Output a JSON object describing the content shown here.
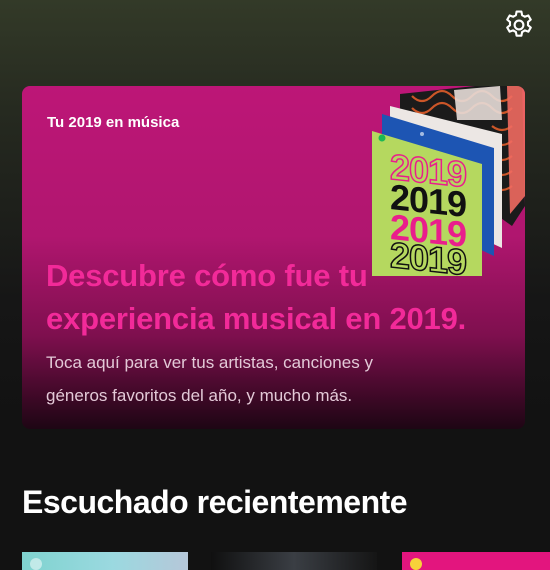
{
  "settings": {
    "icon": "gear-icon"
  },
  "banner": {
    "eyebrow": "Tu 2019 en música",
    "headline_line1": "Descubre cómo fue tu",
    "headline_line2": "experiencia musical en 2019.",
    "body_line1": "Toca aquí para ver tus artistas, canciones y",
    "body_line2": "géneros favoritos del año, y mucho más.",
    "cover_year": "2019",
    "colors": {
      "accent": "#f22a99",
      "background": "#bd1677",
      "cover_green": "#b5d85f"
    }
  },
  "recent": {
    "title": "Escuchado recientemente"
  }
}
